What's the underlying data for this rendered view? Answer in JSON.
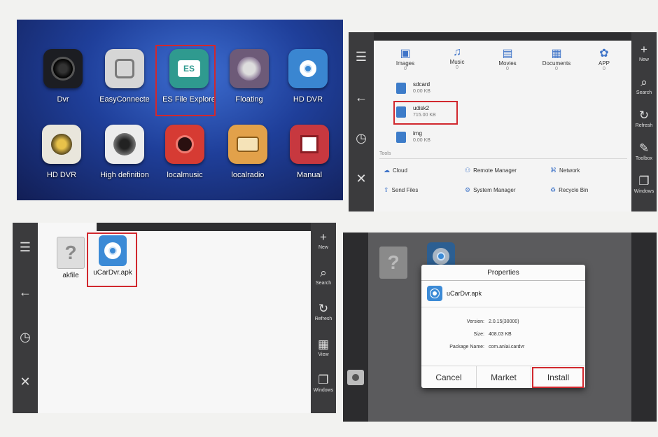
{
  "launcher": {
    "apps": [
      {
        "label": "Dvr"
      },
      {
        "label": "EasyConnecte"
      },
      {
        "label": "ES File Explore"
      },
      {
        "label": "Floating"
      },
      {
        "label": "HD DVR"
      },
      {
        "label": "HD DVR"
      },
      {
        "label": "High definition"
      },
      {
        "label": "localmusic"
      },
      {
        "label": "localradio"
      },
      {
        "label": "Manual"
      }
    ]
  },
  "explorer": {
    "categories": [
      {
        "label": "Images",
        "count": "0"
      },
      {
        "label": "Music",
        "count": "0"
      },
      {
        "label": "Movies",
        "count": "0"
      },
      {
        "label": "Documents",
        "count": "0"
      },
      {
        "label": "APP",
        "count": "0"
      }
    ],
    "files": [
      {
        "name": "sdcard",
        "size": "0.00 KB"
      },
      {
        "name": "udisk2",
        "size": "715.00 KB"
      },
      {
        "name": "img",
        "size": "0.00 KB"
      }
    ],
    "tools_label": "Tools",
    "tools": [
      {
        "label": "Cloud"
      },
      {
        "label": "Remote Manager"
      },
      {
        "label": "Network"
      },
      {
        "label": "Send Files"
      },
      {
        "label": "System Manager"
      },
      {
        "label": "Recycle Bin"
      }
    ],
    "right_bar": [
      "New",
      "Search",
      "Refresh",
      "Toolbox",
      "Windows"
    ]
  },
  "file_list": {
    "items": [
      {
        "label": "akfile"
      },
      {
        "label": "uCarDvr.apk"
      }
    ],
    "right_bar": [
      "New",
      "Search",
      "Refresh",
      "View",
      "Windows"
    ]
  },
  "properties": {
    "title": "Properties",
    "file_name": "uCarDvr.apk",
    "version_label": "Version:",
    "version_value": "2.0.15(30000)",
    "size_label": "Size:",
    "size_value": "408.03 KB",
    "package_label": "Package Name:",
    "package_value": "com.anlai.cardvr",
    "cancel": "Cancel",
    "market": "Market",
    "install": "Install"
  },
  "colors": {
    "highlight": "#d1282e",
    "accent": "#3b8ad6",
    "launcher_bg": "#1f3f9a"
  }
}
